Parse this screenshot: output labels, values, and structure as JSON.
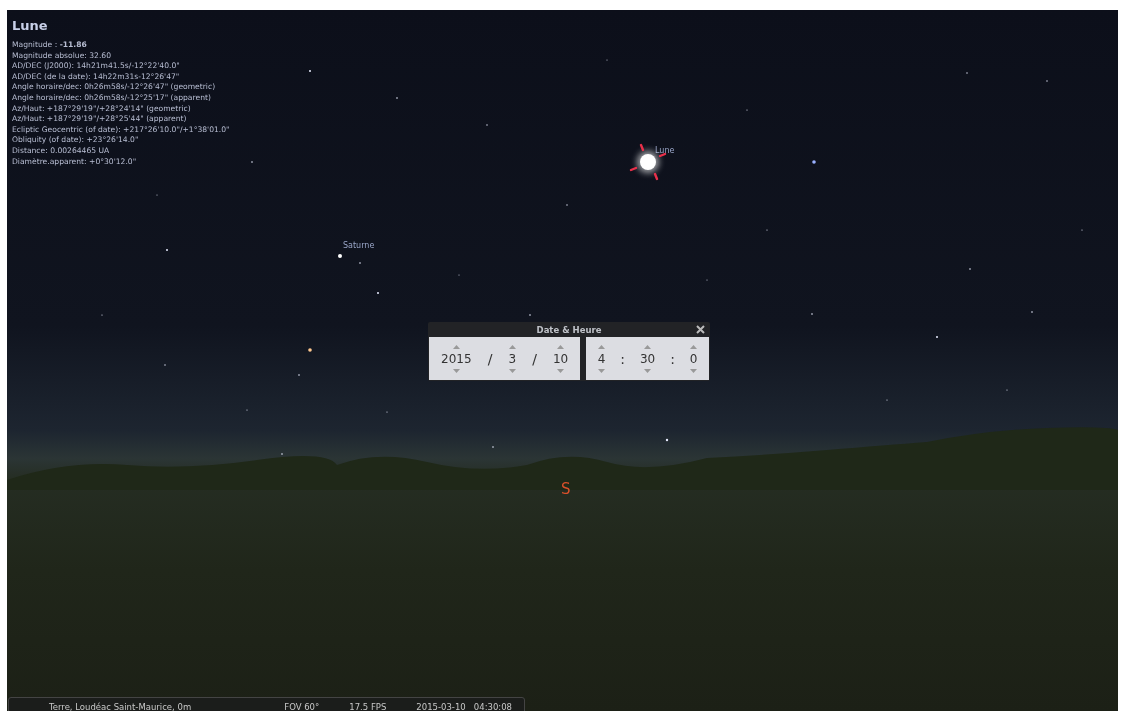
{
  "info": {
    "title": "Lune",
    "lines": [
      "Magnitude : **-11.86**",
      "Magnitude absolue: 32.60",
      "AD/DEC (J2000): 14h21m41.5s/-12°22'40.0\"",
      "AD/DEC (de la date): 14h22m31s-12°26'47\"",
      "Angle horaire/dec: 0h26m58s/-12°26'47\" (geometric)",
      "Angle horaire/dec: 0h26m58s/-12°25'17\" (apparent)",
      "Az/Haut: +187°29'19\"/+28°24'14\" (geometric)",
      "Az/Haut: +187°29'19\"/+28°25'44\" (apparent)",
      "Ecliptic Geocentric (of date): +217°26'10.0\"/+1°38'01.0\"",
      "Obliquity (of date): +23°26'14.0\"",
      "Distance: 0.00264465 UA",
      "Diamètre.apparent: +0°30'12.0\""
    ]
  },
  "sky_objects": [
    {
      "label": "Lune",
      "kind": "moon",
      "selected": true
    },
    {
      "label": "Saturne",
      "kind": "planet",
      "selected": false
    },
    {
      "label": "S",
      "kind": "cardinal"
    }
  ],
  "dialog": {
    "title": "Date & Heure",
    "date": [
      {
        "kind": "value",
        "text": "2015"
      },
      {
        "kind": "sep",
        "text": "/"
      },
      {
        "kind": "value",
        "text": "3"
      },
      {
        "kind": "sep",
        "text": "/"
      },
      {
        "kind": "value",
        "text": "10"
      }
    ],
    "time": [
      {
        "kind": "value",
        "text": "4"
      },
      {
        "kind": "sep",
        "text": ":"
      },
      {
        "kind": "value",
        "text": "30"
      },
      {
        "kind": "sep",
        "text": ":"
      },
      {
        "kind": "value",
        "text": "0"
      }
    ]
  },
  "status_bar": {
    "location": "Terre, Loudéac Saint-Maurice, 0m",
    "fov": "FOV 60°",
    "fps": "17.5 FPS",
    "datetime": "2015-03-10   04:30:08"
  }
}
